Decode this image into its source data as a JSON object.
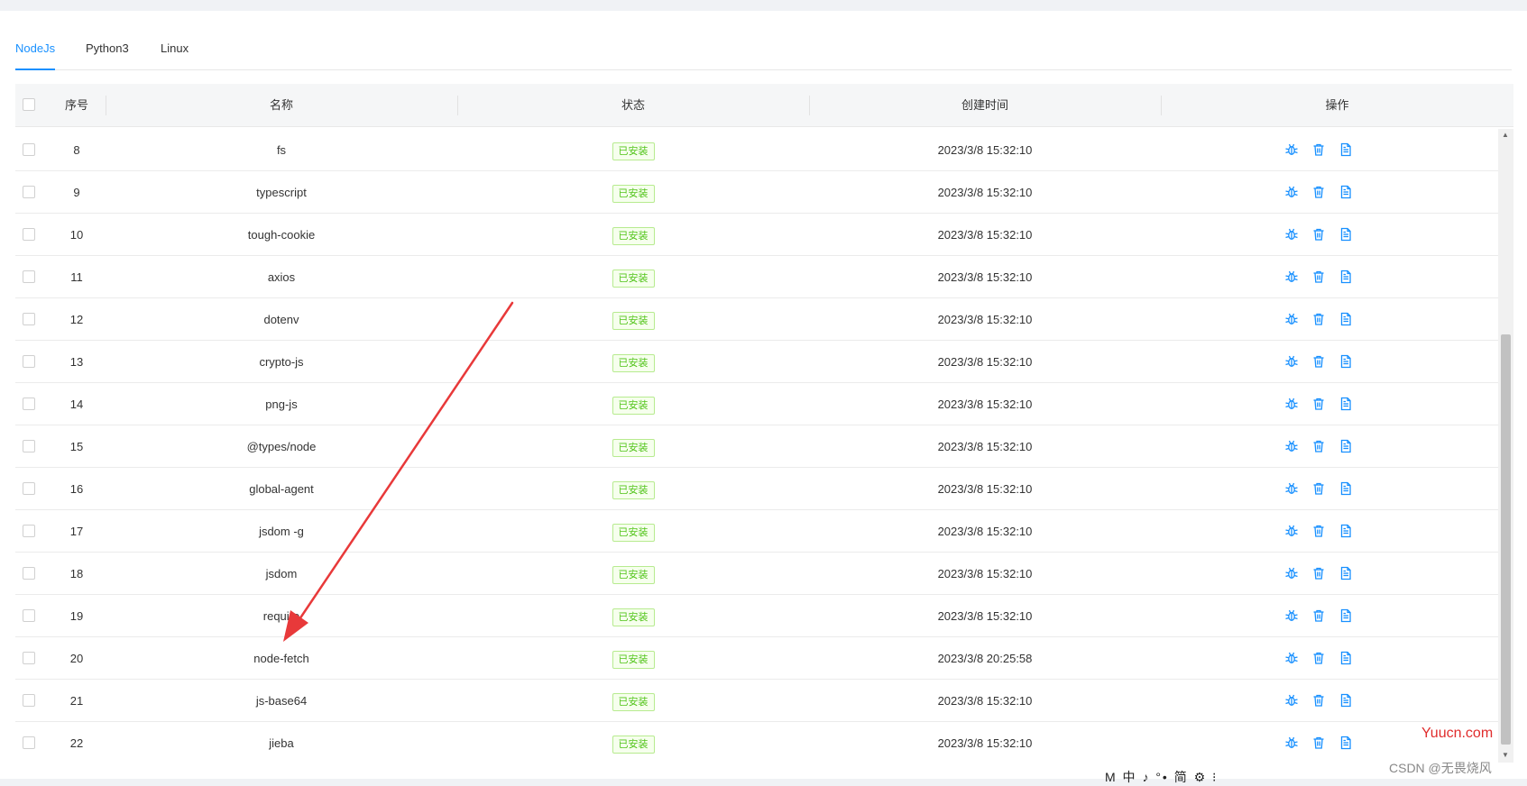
{
  "tabs": [
    {
      "label": "NodeJs",
      "active": true
    },
    {
      "label": "Python3",
      "active": false
    },
    {
      "label": "Linux",
      "active": false
    }
  ],
  "table": {
    "columns": {
      "index": "序号",
      "name": "名称",
      "status": "状态",
      "created": "创建时间",
      "actions": "操作"
    },
    "rows": [
      {
        "index": "8",
        "name": "fs",
        "status": "已安装",
        "created": "2023/3/8 15:32:10"
      },
      {
        "index": "9",
        "name": "typescript",
        "status": "已安装",
        "created": "2023/3/8 15:32:10"
      },
      {
        "index": "10",
        "name": "tough-cookie",
        "status": "已安装",
        "created": "2023/3/8 15:32:10"
      },
      {
        "index": "11",
        "name": "axios",
        "status": "已安装",
        "created": "2023/3/8 15:32:10"
      },
      {
        "index": "12",
        "name": "dotenv",
        "status": "已安装",
        "created": "2023/3/8 15:32:10"
      },
      {
        "index": "13",
        "name": "crypto-js",
        "status": "已安装",
        "created": "2023/3/8 15:32:10"
      },
      {
        "index": "14",
        "name": "png-js",
        "status": "已安装",
        "created": "2023/3/8 15:32:10"
      },
      {
        "index": "15",
        "name": "@types/node",
        "status": "已安装",
        "created": "2023/3/8 15:32:10"
      },
      {
        "index": "16",
        "name": "global-agent",
        "status": "已安装",
        "created": "2023/3/8 15:32:10"
      },
      {
        "index": "17",
        "name": "jsdom -g",
        "status": "已安装",
        "created": "2023/3/8 15:32:10"
      },
      {
        "index": "18",
        "name": "jsdom",
        "status": "已安装",
        "created": "2023/3/8 15:32:10"
      },
      {
        "index": "19",
        "name": "require",
        "status": "已安装",
        "created": "2023/3/8 15:32:10"
      },
      {
        "index": "20",
        "name": "node-fetch",
        "status": "已安装",
        "created": "2023/3/8 20:25:58"
      },
      {
        "index": "21",
        "name": "js-base64",
        "status": "已安装",
        "created": "2023/3/8 15:32:10"
      },
      {
        "index": "22",
        "name": "jieba",
        "status": "已安装",
        "created": "2023/3/8 15:32:10"
      }
    ],
    "action_icons": [
      "debug-icon",
      "trash-icon",
      "log-file-icon"
    ]
  },
  "colors": {
    "accent": "#1890ff",
    "success": "#52c41a",
    "annotation_arrow": "#e8393a"
  },
  "watermarks": {
    "site": "Yuucn.com",
    "author": "CSDN @无畏烧风"
  },
  "ime_bar": "M 中 ♪ °• 简 ⚙ ⁝"
}
